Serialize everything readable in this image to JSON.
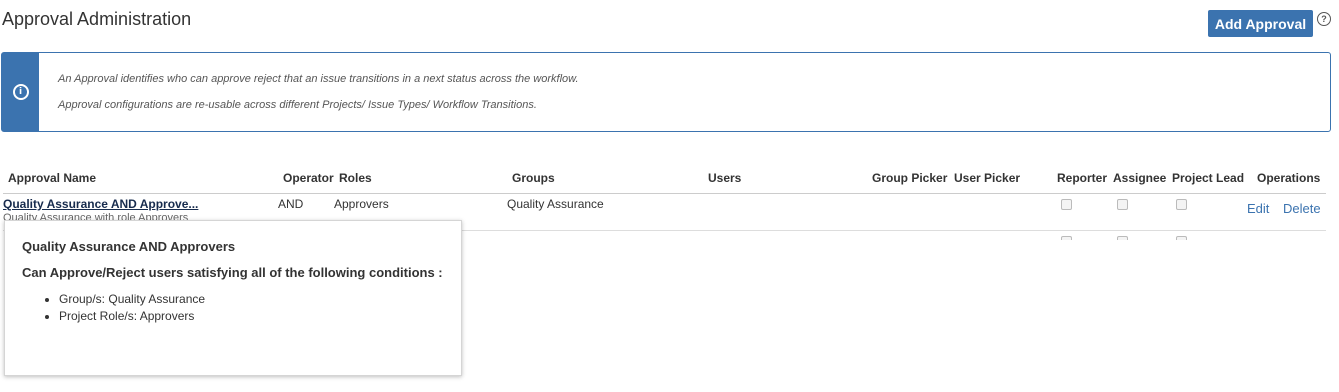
{
  "page": {
    "title": "Approval Administration",
    "add_button": "Add Approval",
    "help_icon": "?"
  },
  "info": {
    "icon": "i",
    "line1": "An Approval identifies who can approve reject that an issue transitions in a next status across the workflow.",
    "line2": "Approval configurations are re-usable across different Projects/ Issue Types/ Workflow Transitions."
  },
  "table": {
    "columns": {
      "name": "Approval Name",
      "operator": "Operator",
      "roles": "Roles",
      "groups": "Groups",
      "users": "Users",
      "group_picker": "Group Picker",
      "user_picker": "User Picker",
      "reporter": "Reporter",
      "assignee": "Assignee",
      "project_lead": "Project Lead",
      "operations": "Operations"
    },
    "rows": [
      {
        "name": "Quality Assurance AND Approve...",
        "description": "Quality Assurance with role Approvers",
        "operator": "AND",
        "roles": "Approvers",
        "groups": "Quality Assurance",
        "users": "",
        "group_picker": "",
        "user_picker": "",
        "reporter": false,
        "assignee": false,
        "project_lead": false,
        "edit": "Edit",
        "delete": "Delete"
      }
    ]
  },
  "popup": {
    "title": "Quality Assurance AND Approvers",
    "subtitle": "Can Approve/Reject users satisfying all of the following conditions :",
    "items": [
      "Group/s: Quality Assurance",
      "Project Role/s: Approvers"
    ]
  },
  "colors": {
    "accent": "#3b73af",
    "text": "#333333",
    "border": "#cccccc"
  }
}
